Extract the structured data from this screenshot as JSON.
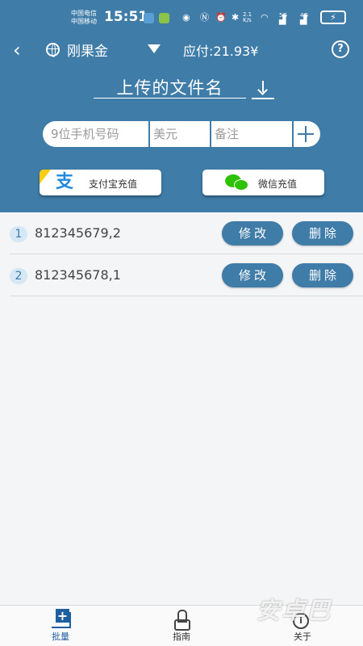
{
  "status_bar": {
    "carrier1": "中国电信",
    "carrier2": "中国移动",
    "time": "15:51",
    "speed": "2.1 K/s",
    "net1": "5G",
    "net2": "4G",
    "icons": [
      "usb-icon",
      "android-icon",
      "eye-icon",
      "nfc-icon",
      "alarm-icon",
      "bluetooth-icon",
      "wifi-icon",
      "signal-icon",
      "battery-charging-icon"
    ]
  },
  "top_bar": {
    "currency": "刚果金",
    "amount": "应付:21.93¥",
    "help": "?"
  },
  "upload": {
    "filename": "上传的文件名"
  },
  "form": {
    "phone_placeholder": "9位手机号码",
    "usd_placeholder": "美元",
    "note_placeholder": "备注"
  },
  "recharge": {
    "alipay_label": "支付宝充值",
    "alipay_glyph": "支",
    "wechat_label": "微信充值"
  },
  "list": {
    "items": [
      {
        "index": "1",
        "text": "812345679,2",
        "edit": "修改",
        "delete": "删除"
      },
      {
        "index": "2",
        "text": "812345678,1",
        "edit": "修改",
        "delete": "删除"
      }
    ]
  },
  "nav": {
    "batch": "批量",
    "guide": "指南",
    "about": "关于",
    "about_glyph": "i"
  },
  "watermark": "安卓巴",
  "colors": {
    "primary": "#3f7ca8",
    "accent": "#1e5fa0",
    "background": "#f4f5f7"
  }
}
